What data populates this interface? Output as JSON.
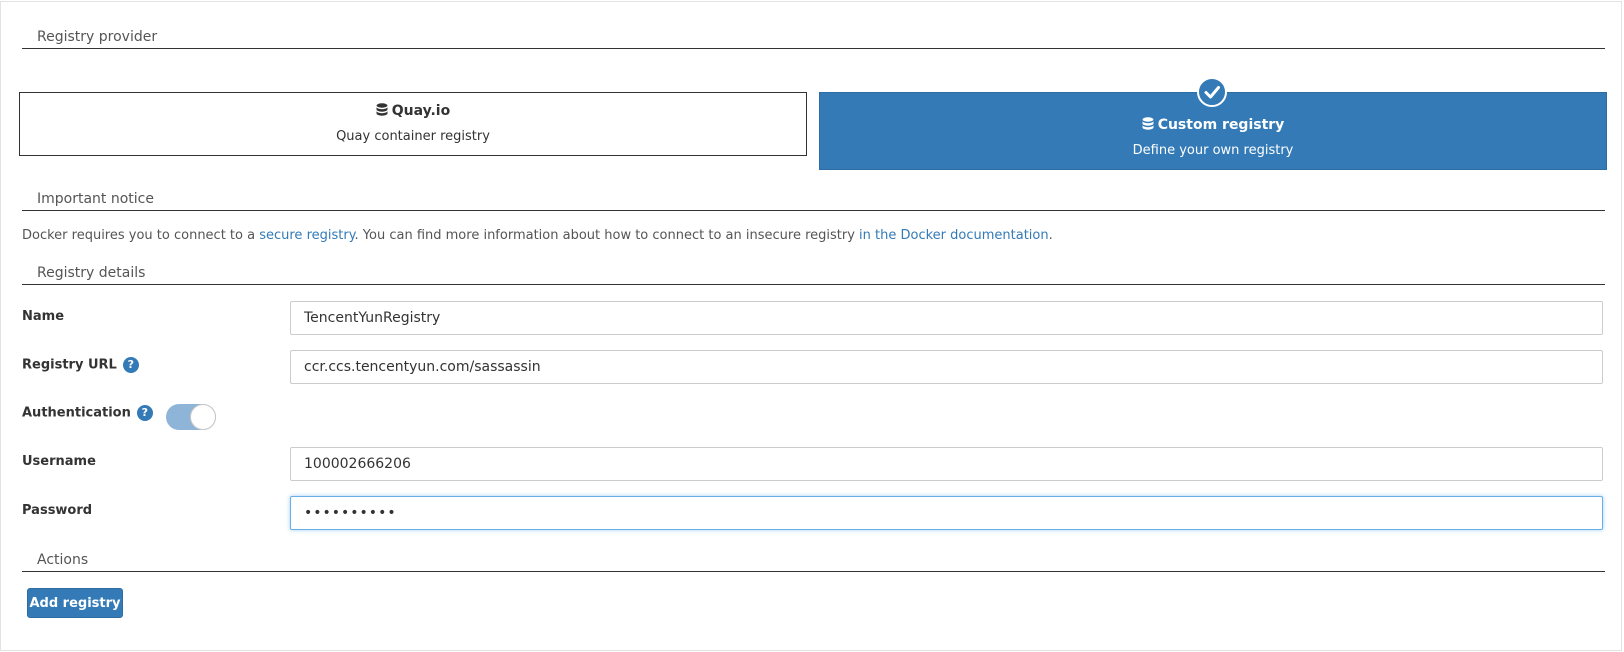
{
  "sections": {
    "provider": "Registry provider",
    "notice": "Important notice",
    "details": "Registry details",
    "actions": "Actions"
  },
  "providers": [
    {
      "title": "Quay.io",
      "subtitle": "Quay container registry",
      "icon": "database-icon",
      "selected": false
    },
    {
      "title": "Custom registry",
      "subtitle": "Define your own registry",
      "icon": "database-icon",
      "selected": true
    }
  ],
  "notice": {
    "part1": "Docker requires you to connect to a ",
    "link1": "secure registry",
    "part2": ". You can find more information about how to connect to an insecure registry ",
    "link2": "in the Docker documentation",
    "part3": "."
  },
  "form": {
    "name_label": "Name",
    "name_value": "TencentYunRegistry",
    "url_label": "Registry URL",
    "url_value": "ccr.ccs.tencentyun.com/sassassin",
    "auth_label": "Authentication",
    "auth_enabled": true,
    "username_label": "Username",
    "username_value": "100002666206",
    "password_label": "Password",
    "password_value": "••••••••••"
  },
  "actions": {
    "add_label": "Add registry"
  },
  "colors": {
    "primary": "#337ab7",
    "toggle_on": "#8eb4d8"
  }
}
